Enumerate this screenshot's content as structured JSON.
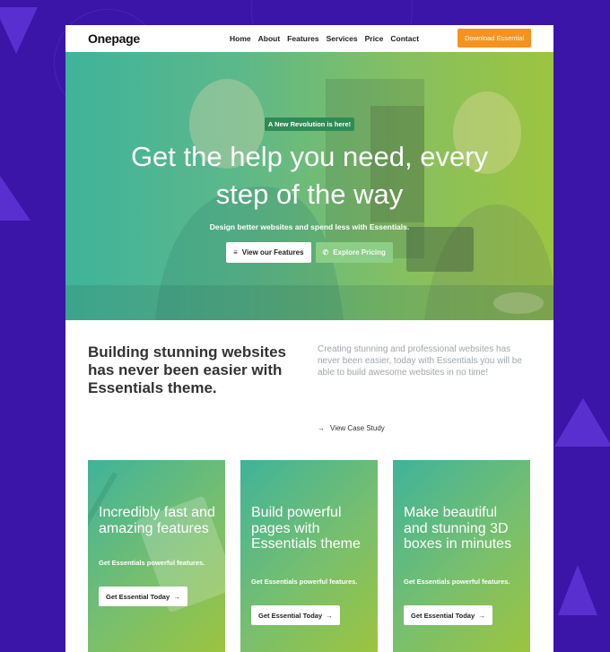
{
  "nav": {
    "brand": "Onepage",
    "links": [
      "Home",
      "About",
      "Features",
      "Services",
      "Price",
      "Contact"
    ],
    "cta": "Download Essential"
  },
  "hero": {
    "badge": "A New Revolution is here!",
    "title_line1": "Get the help you need, every",
    "title_line2": "step of the way",
    "subtitle": "Design better websites and spend less with Essentials.",
    "btn_features": "View our Features",
    "btn_pricing": "Explore Pricing"
  },
  "intro": {
    "heading": "Building stunning websites has never been easier with Essentials theme.",
    "text": "Creating stunning and professional websites has never been easier, today with Essentials you will be able to build awesome websites in no time!",
    "link": "View Case Study"
  },
  "cards": [
    {
      "title": "Incredibly fast and amazing features",
      "desc": "Get Essentials powerful features.",
      "btn": "Get Essential Today"
    },
    {
      "title": "Build powerful pages with Essentials theme",
      "desc": "Get Essentials powerful features.",
      "btn": "Get Essential Today"
    },
    {
      "title": "Make beautiful and stunning 3D boxes in minutes",
      "desc": "Get Essentials powerful features.",
      "btn": "Get Essential Today"
    }
  ],
  "colors": {
    "background": "#3b14a8",
    "accent_orange": "#f7921e",
    "gradient_teal": "#3fb39a",
    "gradient_lime": "#9cc43f"
  }
}
